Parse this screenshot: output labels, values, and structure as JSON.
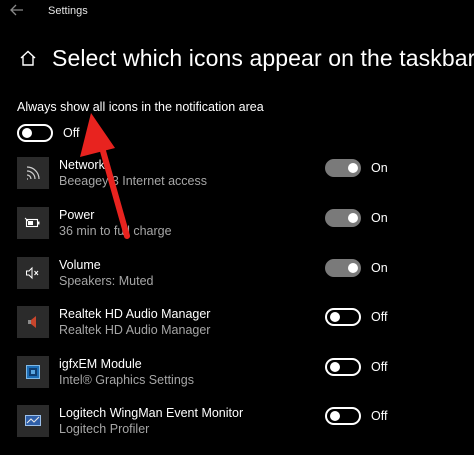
{
  "titlebar": {
    "app_title": "Settings",
    "back_icon": "back-arrow-icon"
  },
  "header": {
    "home_icon": "home-icon",
    "title": "Select which icons appear on the taskbar"
  },
  "always_show": {
    "label": "Always show all icons in the notification area",
    "state": "Off",
    "on": false
  },
  "items": [
    {
      "name": "Network",
      "subtitle": "Beeagey 3 Internet access",
      "icon": "network-icon",
      "state": "On",
      "on": true
    },
    {
      "name": "Power",
      "subtitle": "36 min to full charge",
      "icon": "battery-icon",
      "state": "On",
      "on": true
    },
    {
      "name": "Volume",
      "subtitle": "Speakers: Muted",
      "icon": "volume-muted-icon",
      "state": "On",
      "on": true
    },
    {
      "name": "Realtek HD Audio Manager",
      "subtitle": "Realtek HD Audio Manager",
      "icon": "speaker-icon",
      "state": "Off",
      "on": false
    },
    {
      "name": "igfxEM Module",
      "subtitle": "Intel® Graphics Settings",
      "icon": "intel-graphics-icon",
      "state": "Off",
      "on": false
    },
    {
      "name": "Logitech WingMan Event Monitor",
      "subtitle": "Logitech Profiler",
      "icon": "logitech-icon",
      "state": "Off",
      "on": false
    }
  ],
  "colors": {
    "background": "#000000",
    "text": "#ffffff",
    "subtext": "#a6a6a6",
    "toggle_on": "#7a7a7a",
    "arrow": "#e8231f"
  }
}
